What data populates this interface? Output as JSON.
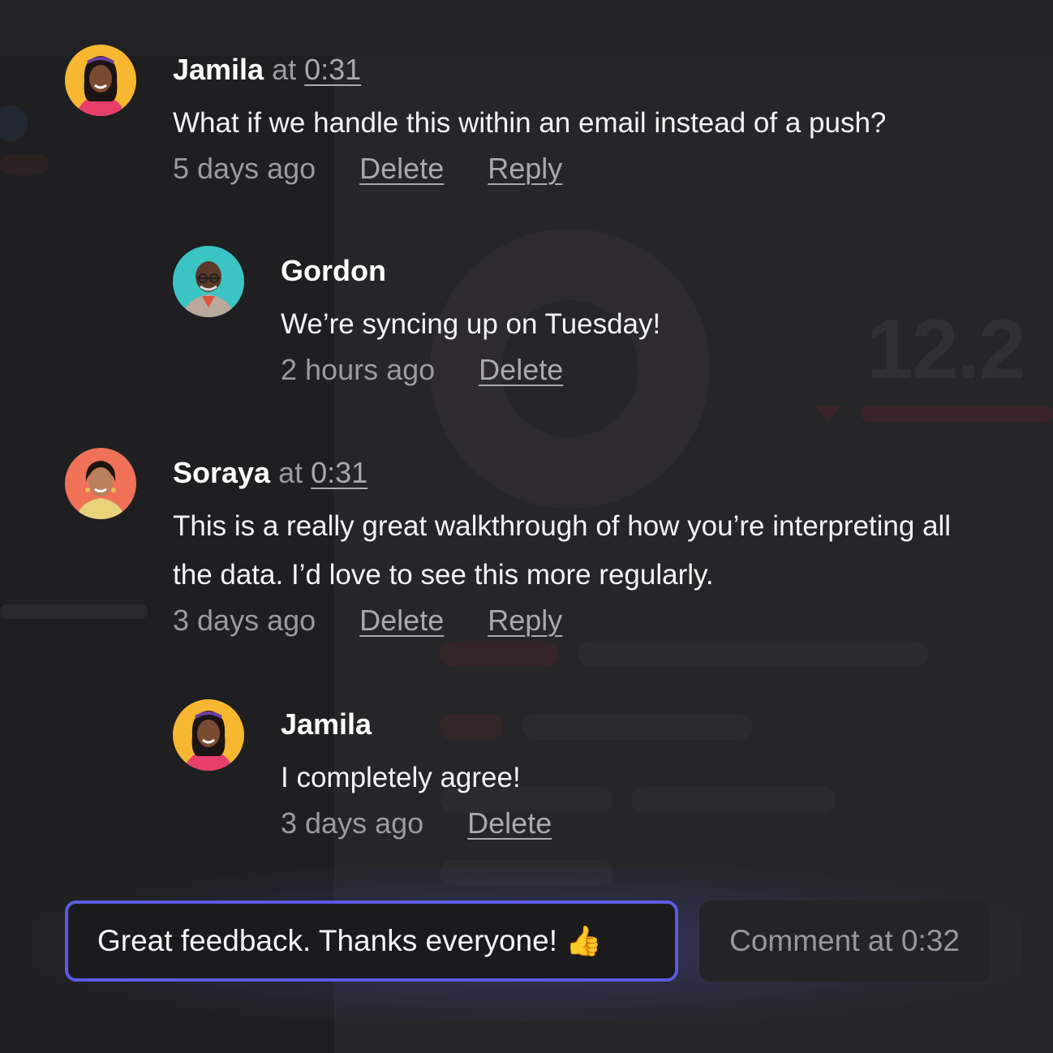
{
  "comments": [
    {
      "author": "Jamila",
      "at_label": "at",
      "timestamp": "0:31",
      "text_lines": [
        "What if we handle this within an email instead of a push?"
      ],
      "age": "5 days ago",
      "delete_label": "Delete",
      "reply_label": "Reply",
      "replies": [
        {
          "author": "Gordon",
          "text_lines": [
            "We’re syncing up on Tuesday!"
          ],
          "age": "2 hours ago",
          "delete_label": "Delete"
        }
      ]
    },
    {
      "author": "Soraya",
      "at_label": "at",
      "timestamp": "0:31",
      "text_lines": [
        "This is a really great walkthrough of how you’re interpreting all",
        "the data. I’d love to see this more regularly."
      ],
      "age": "3 days ago",
      "delete_label": "Delete",
      "reply_label": "Reply",
      "replies": [
        {
          "author": "Jamila",
          "text_lines": [
            "I completely agree!"
          ],
          "age": "3 days ago",
          "delete_label": "Delete"
        }
      ]
    }
  ],
  "composer": {
    "value": "Great feedback. Thanks everyone!",
    "emoji": "👍",
    "submit_label": "Comment at 0:32"
  },
  "background": {
    "big_number": "12.2"
  },
  "colors": {
    "accent_border": "#5a5be0",
    "background": "#1f1f21",
    "name_text": "#ffffff",
    "muted_text": "#9a9aa0"
  }
}
